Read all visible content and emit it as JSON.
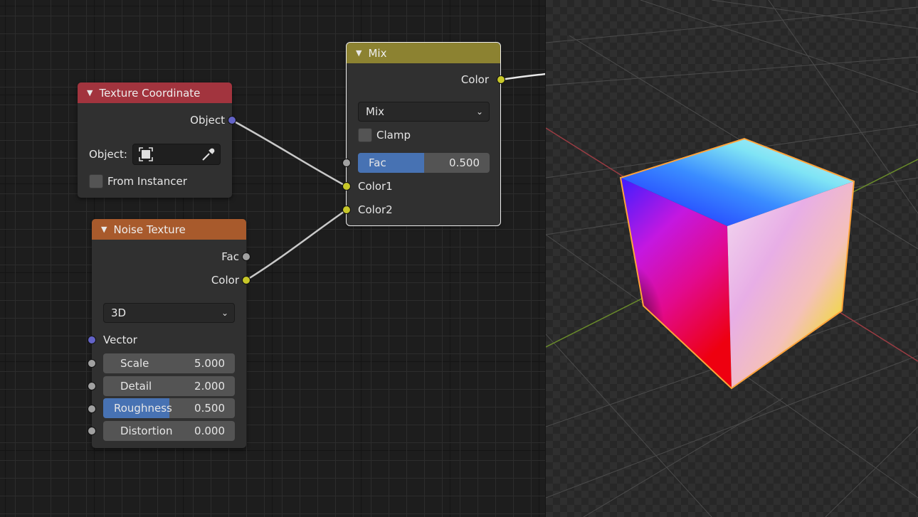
{
  "nodes": {
    "texture_coordinate": {
      "title": "Texture Coordinate",
      "output_object": "Object",
      "object_label": "Object:",
      "from_instancer": "From Instancer"
    },
    "noise_texture": {
      "title": "Noise Texture",
      "output_fac": "Fac",
      "output_color": "Color",
      "dimensions": "3D",
      "input_vector": "Vector",
      "fields": [
        {
          "label": "Scale",
          "value": "5.000",
          "fill": 0
        },
        {
          "label": "Detail",
          "value": "2.000",
          "fill": 0
        },
        {
          "label": "Roughness",
          "value": "0.500",
          "fill": 0.5
        },
        {
          "label": "Distortion",
          "value": "0.000",
          "fill": 0
        }
      ]
    },
    "mix": {
      "title": "Mix",
      "output_color": "Color",
      "blend_mode": "Mix",
      "clamp": "Clamp",
      "fac_label": "Fac",
      "fac_value": "0.500",
      "fac_fill": 0.5,
      "input_color1": "Color1",
      "input_color2": "Color2"
    }
  },
  "colors": {
    "header_texture_coordinate": "#a2343e",
    "header_noise_texture": "#a85a2c",
    "header_mix": "#8c8231",
    "socket_color": "#c7c729",
    "socket_vector": "#6363c7",
    "socket_float": "#a1a1a1",
    "slider_fill": "#4772b3",
    "selection_outline": "#ffa33a"
  },
  "icons": {
    "collapse": "triangle-down-icon",
    "object_field": "object-cube-icon",
    "eyedropper": "eyedropper-icon",
    "dropdown": "chevron-down-icon"
  }
}
